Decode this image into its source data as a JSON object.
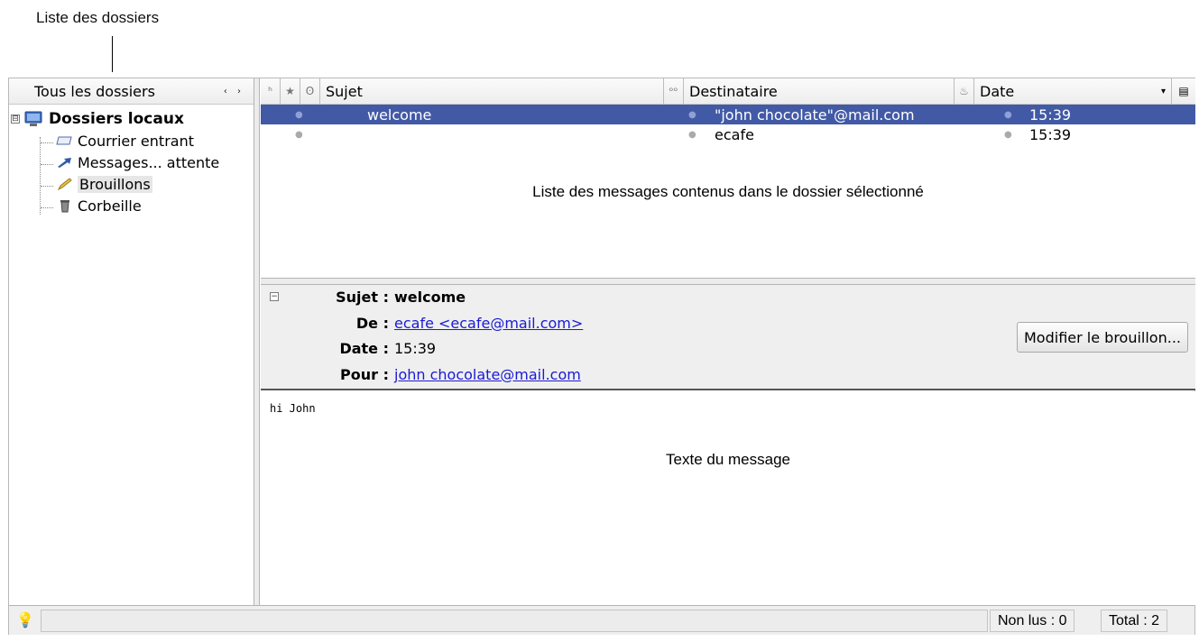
{
  "annotations": {
    "folder_list": "Liste des dossiers",
    "message_list": "Liste des messages contenus dans le dossier sélectionné",
    "message_text": "Texte du message"
  },
  "folders": {
    "header": "Tous les dossiers",
    "nav_arrows": "‹ ›",
    "root": {
      "label": "Dossiers locaux",
      "icon": "monitor-icon",
      "expander": "⊟"
    },
    "items": [
      {
        "label": "Courrier entrant",
        "icon": "inbox-icon"
      },
      {
        "label": "Messages... attente",
        "icon": "arrow-icon"
      },
      {
        "label": "Brouillons",
        "icon": "pencil-icon"
      },
      {
        "label": "Corbeille",
        "icon": "trash-icon"
      }
    ]
  },
  "message_list": {
    "columns": {
      "subject": "Sujet",
      "recipient": "Destinataire",
      "date": "Date"
    },
    "rows": [
      {
        "subject": "welcome",
        "recipient": "\"john chocolate\"@mail.com",
        "date": "15:39",
        "selected": true
      },
      {
        "subject": "",
        "recipient": "ecafe",
        "date": "15:39",
        "selected": false
      }
    ]
  },
  "headers": {
    "subject": {
      "key": "Sujet :",
      "value": "welcome"
    },
    "from": {
      "key": "De :",
      "value": "ecafe <ecafe@mail.com>"
    },
    "date": {
      "key": "Date :",
      "value": "15:39"
    },
    "to": {
      "key": "Pour :",
      "value": "john chocolate@mail.com"
    },
    "edit_button": "Modifier le brouillon..."
  },
  "body": {
    "text": "hi John"
  },
  "status": {
    "unread": "Non lus : 0",
    "total": "Total : 2"
  },
  "colors": {
    "selection": "#425aa6",
    "link": "#1a1ad6"
  }
}
